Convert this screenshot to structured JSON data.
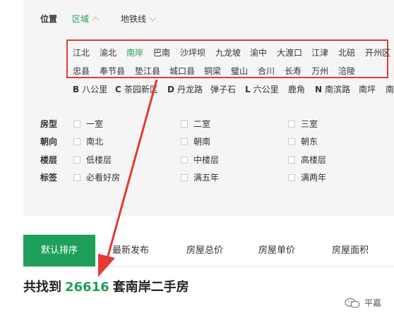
{
  "filters": {
    "position_label": "位置",
    "tab_region": "区域",
    "tab_metro": "地铁线"
  },
  "districts_row1": [
    "江北",
    "渝北",
    "南岸",
    "巴南",
    "沙坪坝",
    "九龙坡",
    "渝中",
    "大渡口",
    "江津",
    "北碚",
    "开州区"
  ],
  "districts_row2": [
    "忠县",
    "奉节县",
    "垫江县",
    "城口县",
    "铜梁",
    "璧山",
    "合川",
    "长寿",
    "万州",
    "涪陵"
  ],
  "active_district": "南岸",
  "metro_areas": [
    {
      "letter": "B",
      "name": "八公里"
    },
    {
      "letter": "C",
      "name": "茶园新区"
    },
    {
      "letter": "D",
      "name": "丹龙路"
    },
    {
      "letter": "",
      "name": "弹子石"
    },
    {
      "letter": "L",
      "name": "六公里"
    },
    {
      "letter": "",
      "name": "鹿角"
    },
    {
      "letter": "N",
      "name": "南滨路"
    },
    {
      "letter": "",
      "name": "南坪"
    },
    {
      "letter": "",
      "name": "南"
    }
  ],
  "attributes": [
    {
      "label": "房型",
      "options": [
        "一室",
        "二室",
        "三室"
      ]
    },
    {
      "label": "朝向",
      "options": [
        "南北",
        "朝南",
        "朝东"
      ]
    },
    {
      "label": "楼层",
      "options": [
        "低楼层",
        "中楼层",
        "高楼层"
      ]
    },
    {
      "label": "标签",
      "options": [
        "必看好房",
        "满五年",
        "满两年"
      ]
    }
  ],
  "sort_tabs": [
    "默认排序",
    "最新发布",
    "房屋总价",
    "房屋单价",
    "房屋面积"
  ],
  "result": {
    "prefix": "共找到",
    "count": "26616",
    "suffix": "套南岸二手房"
  },
  "watermark": "平嘉",
  "colors": {
    "accent": "#1fa05a",
    "annotation": "#e53935"
  }
}
